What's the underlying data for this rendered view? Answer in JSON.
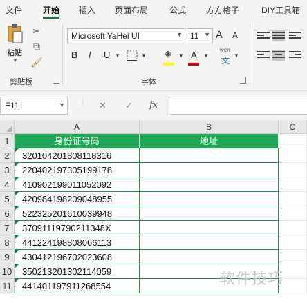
{
  "ribbon_tabs": [
    "文件",
    "开始",
    "插入",
    "页面布局",
    "公式",
    "方方格子",
    "DIY工具箱"
  ],
  "ribbon": {
    "paste_label": "粘贴",
    "clipboard_group": "剪贴板",
    "font_group": "字体",
    "font_name": "Microsoft YaHei UI",
    "font_size": "11",
    "bold": "B",
    "italic": "I",
    "underline": "U",
    "font_color_glyph": "A",
    "wen_glyph": "wén",
    "wen_char": "文",
    "grow_font": "A",
    "shrink_font": "A",
    "fill_color": "#ffff00",
    "font_color": "#e00000"
  },
  "formula_bar": {
    "name_box": "E11",
    "cancel": "✕",
    "confirm": "✓",
    "fx": "fx",
    "content": ""
  },
  "sheet": {
    "columns": [
      "A",
      "B",
      "C"
    ],
    "rows": [
      "1",
      "2",
      "3",
      "4",
      "5",
      "6",
      "7",
      "8",
      "9",
      "10",
      "11"
    ],
    "headers": [
      "身份证号码",
      "地址"
    ],
    "ids": [
      "320104201808118316",
      "220402197305199178",
      "410902199011052092",
      "420984198209048955",
      "522325201610039948",
      "37091119790211348X",
      "441224198808066113",
      "430412196702023608",
      "350213201302114059",
      "441401197911268554"
    ]
  },
  "watermark": "软件技巧",
  "colors": {
    "accent": "#1e7145",
    "header_fill": "#1fa855"
  }
}
